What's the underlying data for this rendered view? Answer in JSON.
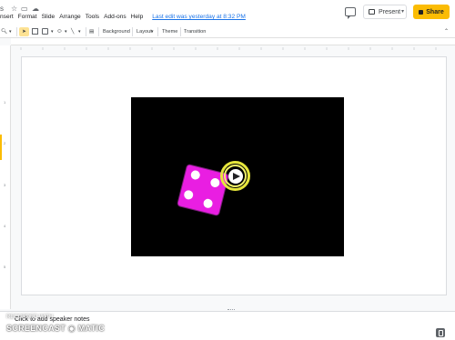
{
  "menu": {
    "items": [
      "nsert",
      "Format",
      "Slide",
      "Arrange",
      "Tools",
      "Add-ons",
      "Help"
    ],
    "last_edit": "Last edit was yesterday at 8:32 PM"
  },
  "header": {
    "present_label": "Present",
    "share_label": "Share"
  },
  "toolbar": {
    "background_label": "Background",
    "layout_label": "Layout",
    "theme_label": "Theme",
    "transition_label": "Transition"
  },
  "ruler": {
    "v_labels": [
      "1",
      "2",
      "3",
      "4",
      "5"
    ]
  },
  "notes": {
    "placeholder": "Click to add speaker notes"
  },
  "watermark": {
    "recorded_with": "RECORDED WITH",
    "brand": "SCREENCAST ◉ MATIC"
  },
  "colors": {
    "accent": "#fbbc04",
    "link": "#1a73e8",
    "dice": "#e91ee2"
  }
}
